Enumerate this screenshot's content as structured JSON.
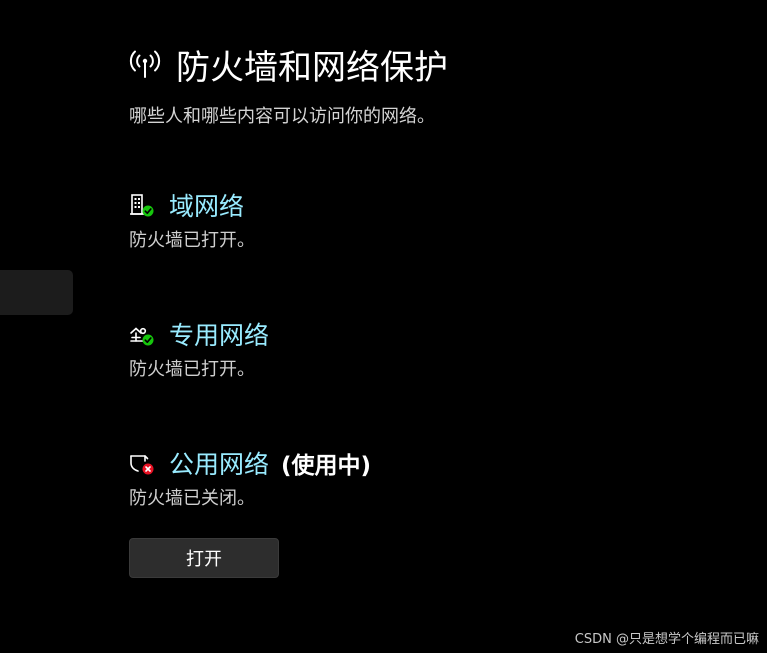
{
  "header": {
    "icon": "antenna-icon",
    "title": "防火墙和网络保护",
    "subtitle": "哪些人和哪些内容可以访问你的网络。"
  },
  "networks": [
    {
      "icon": "domain-network-icon",
      "badge": "check",
      "name": "域网络",
      "active_label": "",
      "status": "防火墙已打开。"
    },
    {
      "icon": "private-network-icon",
      "badge": "check",
      "name": "专用网络",
      "active_label": "",
      "status": "防火墙已打开。"
    },
    {
      "icon": "public-network-icon",
      "badge": "error",
      "name": "公用网络",
      "active_label": "(使用中)",
      "status": "防火墙已关闭。",
      "button_label": "打开"
    }
  ],
  "watermark": "CSDN @只是想学个编程而已嘛",
  "colors": {
    "background": "#000000",
    "link": "#99ebff",
    "status_ok": "#16c60c",
    "status_error": "#e81123",
    "button": "#2d2d2d"
  }
}
